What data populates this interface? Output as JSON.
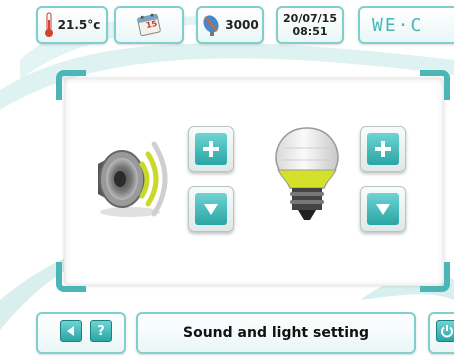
{
  "topbar": {
    "temperature": "21.5°c",
    "calendar_day": "15",
    "count": "3000",
    "date": "20/07/15",
    "time": "08:51",
    "logo_text": "WE·C"
  },
  "main": {
    "sound": {
      "increase_icon": "plus-icon",
      "decrease_icon": "triangle-down-icon"
    },
    "light": {
      "increase_icon": "plus-icon",
      "decrease_icon": "triangle-down-icon"
    }
  },
  "bottombar": {
    "back_icon": "triangle-left-icon",
    "help_label": "?",
    "title": "Sound and light setting",
    "power_icon": "power-icon"
  },
  "colors": {
    "accent": "#4cb6b6",
    "button_teal": "#2aa5a5",
    "bulb_yellow": "#d4e12a"
  }
}
